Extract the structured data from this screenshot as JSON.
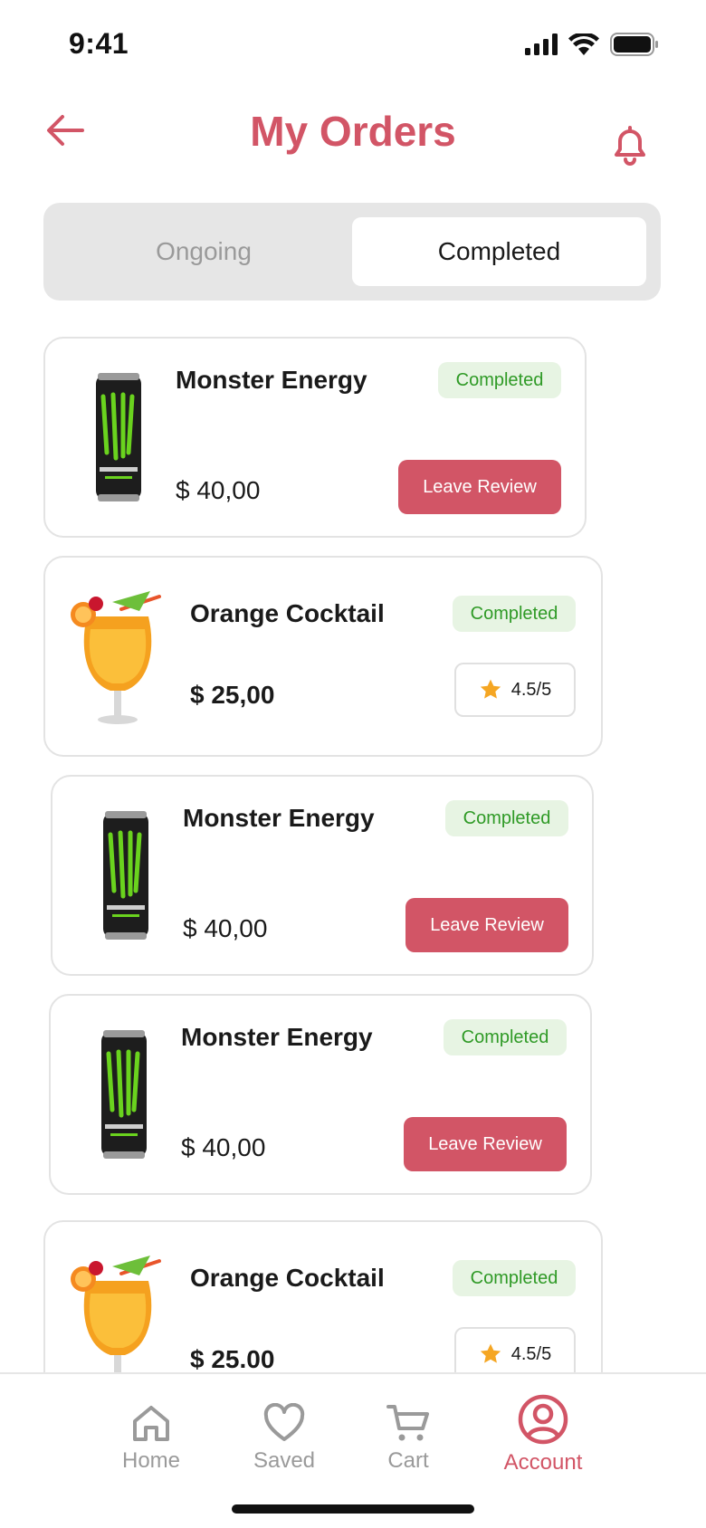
{
  "status_bar": {
    "time": "9:41"
  },
  "header": {
    "title": "My Orders"
  },
  "tabs": [
    {
      "label": "Ongoing",
      "active": false
    },
    {
      "label": "Completed",
      "active": true
    }
  ],
  "orders": [
    {
      "name": "Monster Energy",
      "price": "$ 40,00",
      "status": "Completed",
      "action": "Leave Review",
      "image": "monster-can-icon"
    },
    {
      "name": "Orange Cocktail",
      "price": "$ 25,00",
      "status": "Completed",
      "rating": "4.5/5",
      "image": "cocktail-glass-icon"
    },
    {
      "name": "Monster Energy",
      "price": "$ 40,00",
      "status": "Completed",
      "action": "Leave Review",
      "image": "monster-can-icon"
    },
    {
      "name": "Monster Energy",
      "price": "$ 40,00",
      "status": "Completed",
      "action": "Leave Review",
      "image": "monster-can-icon"
    },
    {
      "name": "Orange Cocktail",
      "price": "$ 25.00",
      "status": "Completed",
      "rating": "4.5/5",
      "image": "cocktail-glass-icon"
    }
  ],
  "bottom_nav": [
    {
      "label": "Home",
      "icon": "home-icon",
      "active": false
    },
    {
      "label": "Saved",
      "icon": "heart-icon",
      "active": false
    },
    {
      "label": "Cart",
      "icon": "cart-icon",
      "active": false
    },
    {
      "label": "Account",
      "icon": "account-icon",
      "active": true
    }
  ],
  "colors": {
    "accent": "#d25566",
    "badge_bg": "#e7f4e3",
    "badge_text": "#2f9a26",
    "star": "#f5a623"
  }
}
